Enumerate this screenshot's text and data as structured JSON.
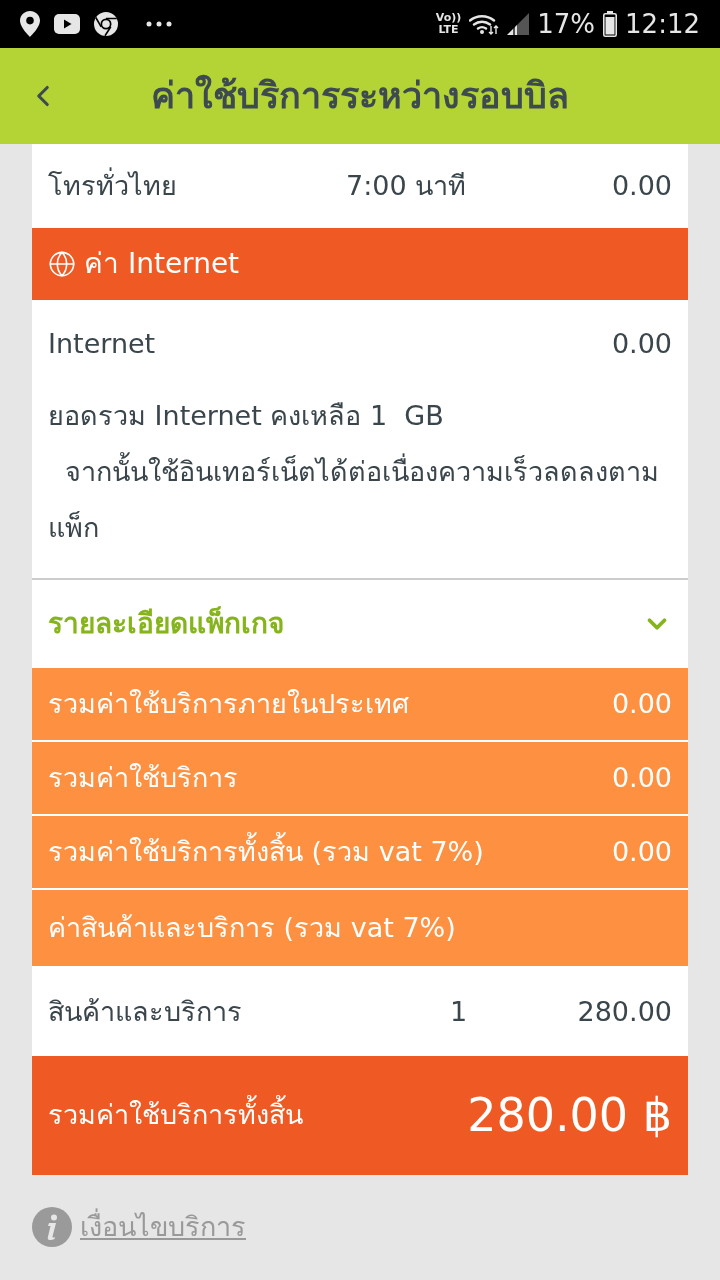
{
  "status_bar": {
    "volte_top": "Vo))",
    "volte_bottom": "LTE",
    "battery": "17%",
    "time": "12:12"
  },
  "header": {
    "title": "ค่าใช้บริการระหว่างรอบบิล"
  },
  "call_rows": [
    {
      "label": "โทรทั่วไทย",
      "amount": "7:00 นาที",
      "price": "0.00"
    }
  ],
  "internet_section": {
    "title": "ค่า Internet",
    "rows": [
      {
        "label": "Internet",
        "price": "0.00"
      }
    ],
    "note": "ยอดรวม Internet คงเหลือ 1  GB\n  จากนั้นใช้อินเทอร์เน็ตได้ต่อเนื่องความเร็วลดลงตามแพ็ก"
  },
  "package_details": {
    "label": "รายละเอียดแพ็กเกจ",
    "expanded": false
  },
  "summary_rows": [
    {
      "label": "รวมค่าใช้บริการภายในประเทศ",
      "value": "0.00"
    },
    {
      "label": "รวมค่าใช้บริการ",
      "value": "0.00"
    },
    {
      "label": "รวมค่าใช้บริการทั้งสิ้น (รวม vat 7%)",
      "value": "0.00"
    },
    {
      "label": "ค่าสินค้าและบริการ (รวม vat 7%)"
    }
  ],
  "product_rows": [
    {
      "label": "สินค้าและบริการ",
      "quantity": "1",
      "price": "280.00"
    }
  ],
  "grand_total": {
    "label": "รวมค่าใช้บริการทั้งสิ้น",
    "value": "280.00 ฿"
  },
  "terms_link": {
    "label": "เงื่อนไขบริการ"
  }
}
